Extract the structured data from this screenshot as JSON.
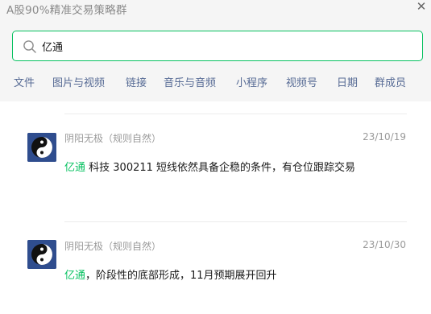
{
  "window": {
    "title": "A股90%精准交易策略群",
    "close_glyph": "✕"
  },
  "search": {
    "value": "亿通",
    "accent_color": "#07c160"
  },
  "tabs": [
    {
      "label": "文件"
    },
    {
      "label": "图片与视频"
    },
    {
      "label": "链接"
    },
    {
      "label": "音乐与音频"
    },
    {
      "label": "小程序"
    },
    {
      "label": "视频号"
    },
    {
      "label": "日期"
    },
    {
      "label": "群成员"
    }
  ],
  "messages": [
    {
      "sender": "阴阳无极（规则自然）",
      "date": "23/10/19",
      "highlight": "亿通",
      "rest": " 科技 300211 短线依然具备企稳的条件，有仓位跟踪交易",
      "avatar_icon": "yin-yang-icon"
    },
    {
      "sender": "阴阳无极（规则自然）",
      "date": "23/10/30",
      "highlight": "亿通",
      "rest": "，阶段性的底部形成，11月预期展开回升",
      "avatar_icon": "yin-yang-icon"
    }
  ]
}
